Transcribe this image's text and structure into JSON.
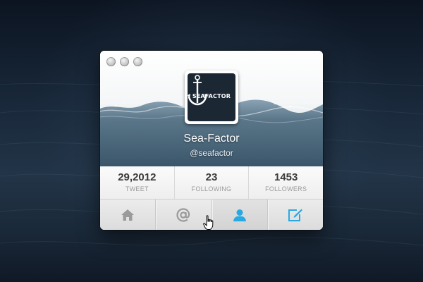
{
  "window": {
    "traffic_lights": [
      "close-button",
      "minimize-button",
      "zoom-button"
    ]
  },
  "profile": {
    "avatar_text": "SEAFACTOR",
    "avatar_icon": "anchor-icon",
    "name": "Sea-Factor",
    "handle": "@seafactor"
  },
  "stats": [
    {
      "value": "29,2012",
      "label": "TWEET"
    },
    {
      "value": "23",
      "label": "FOLLOWING"
    },
    {
      "value": "1453",
      "label": "FOLLOWERS"
    }
  ],
  "toolbar": {
    "items": [
      {
        "icon": "home-icon",
        "active": false
      },
      {
        "icon": "at-icon",
        "active": false
      },
      {
        "icon": "profile-icon",
        "active": true
      },
      {
        "icon": "compose-icon",
        "active": false
      }
    ]
  },
  "colors": {
    "accent": "#29a9e1",
    "icon_grey": "#9a9a9a",
    "stat_number": "#3a3a3a",
    "stat_label": "#9a9a9a",
    "avatar_bg": "#1b2733"
  }
}
